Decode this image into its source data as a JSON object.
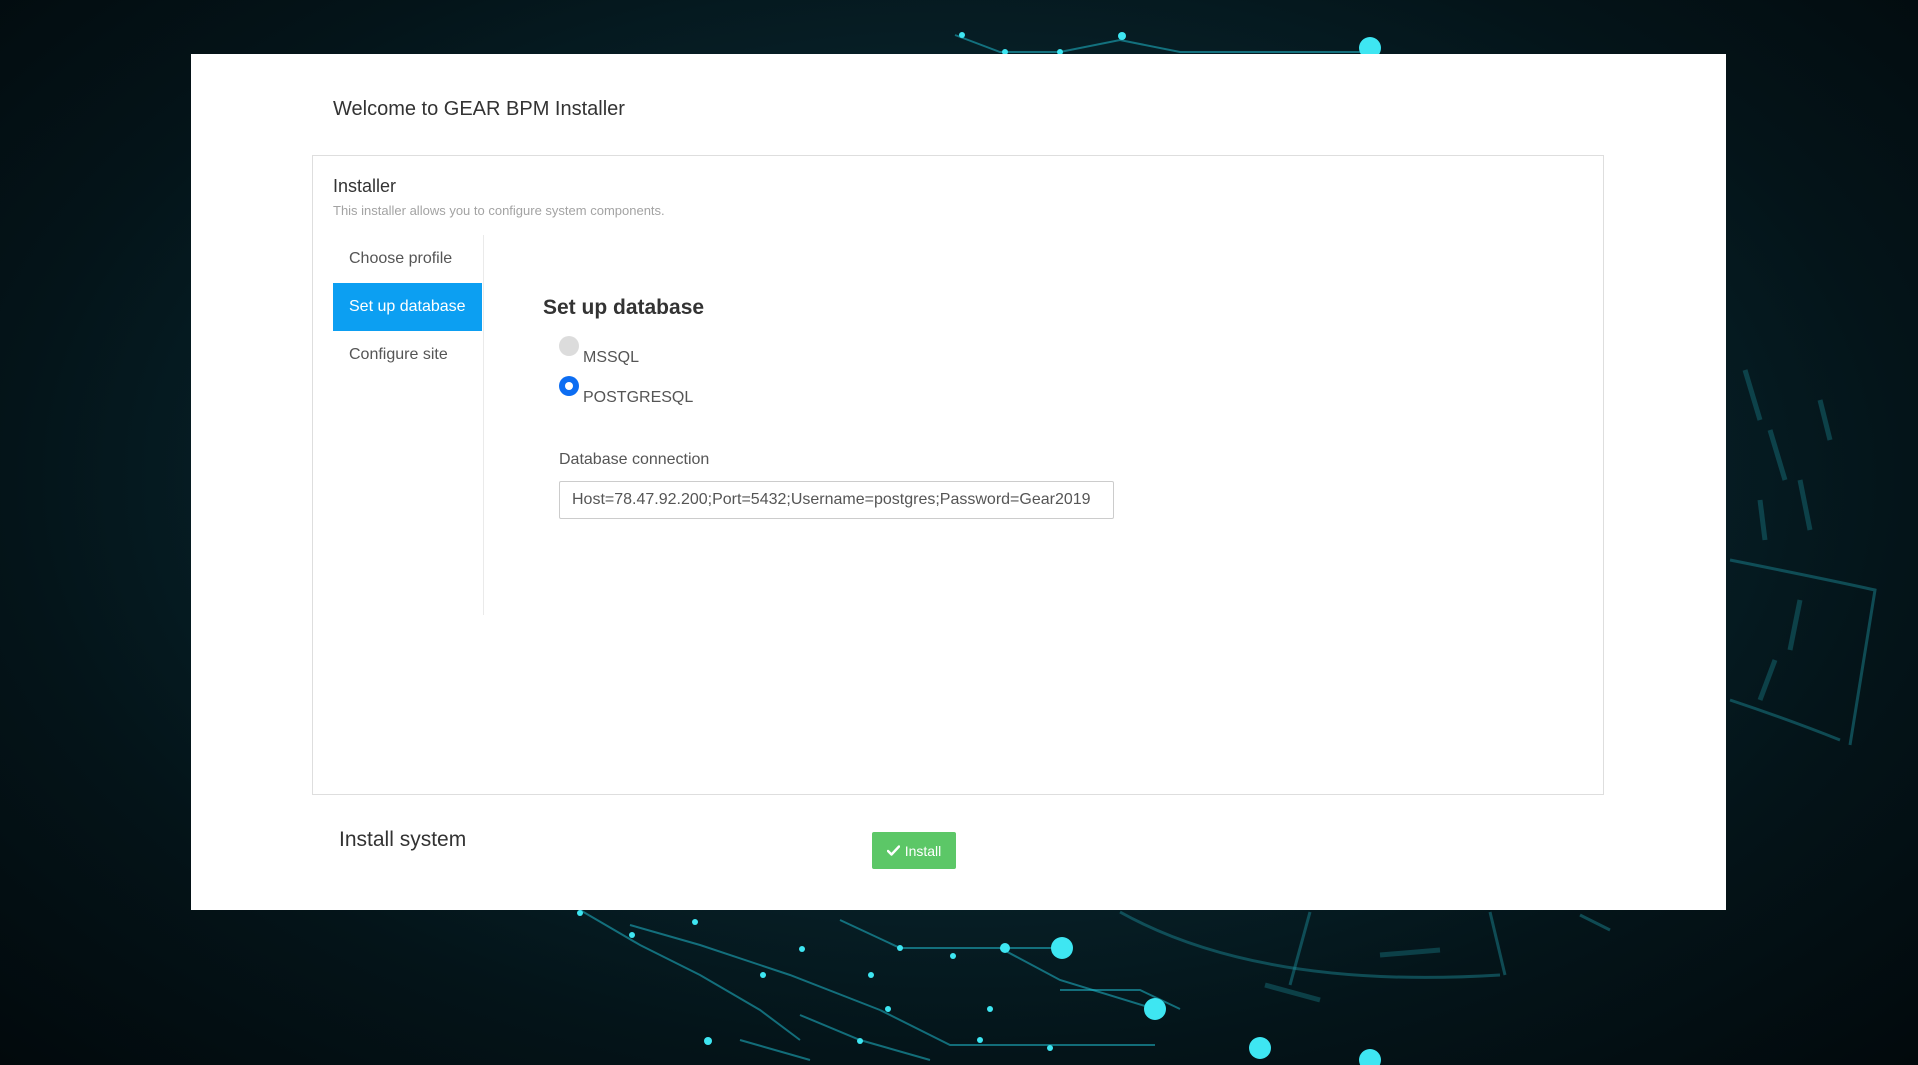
{
  "page": {
    "welcome_title": "Welcome to GEAR BPM Installer"
  },
  "installer": {
    "title": "Installer",
    "subtitle": "This installer allows you to configure system components.",
    "steps": [
      {
        "label": "Choose profile",
        "active": false
      },
      {
        "label": "Set up database",
        "active": true
      },
      {
        "label": "Configure site",
        "active": false
      }
    ]
  },
  "database": {
    "section_title": "Set up database",
    "options": [
      {
        "label": "MSSQL",
        "selected": false
      },
      {
        "label": "POSTGRESQL",
        "selected": true
      }
    ],
    "connection_label": "Database connection",
    "connection_value": "Host=78.47.92.200;Port=5432;Username=postgres;Password=Gear2019"
  },
  "install": {
    "section_title": "Install system",
    "button_label": "Install",
    "button_icon": "check-icon"
  },
  "colors": {
    "accent": "#0c9ff2",
    "radio_selected": "#0c6df2",
    "install_button": "#5cc767"
  }
}
